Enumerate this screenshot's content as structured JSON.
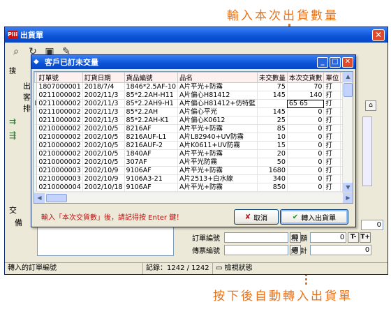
{
  "annotations": {
    "top": "輸入本次出貨數量",
    "bottom": "按下後自動轉入出貨單"
  },
  "outer_window": {
    "title": "出貨單",
    "side_labels": [
      "出",
      "客",
      "排",
      "交",
      "備"
    ],
    "toolbar_label": "搜",
    "fields": {
      "order_no_label": "訂單編號",
      "invoice_no_label": "傳票編號",
      "tax_label": "稅 額",
      "tax_value": "0",
      "total_label": "總 計",
      "total_value": "0",
      "right_value": "0",
      "t_minus": "T-",
      "t_plus": "T+"
    },
    "status_bar": {
      "left": "轉入的訂單編號",
      "records": "記錄：1242 / 1242",
      "mode": "檢視狀態"
    }
  },
  "dialog": {
    "title": "客戶已訂未交量",
    "columns": [
      "訂單號",
      "訂貨日期",
      "貨品編號",
      "品名",
      "未交數量",
      "本次交貨數",
      "單位",
      "單價"
    ],
    "rows": [
      {
        "order": "1807000001",
        "date": "2018/7/4",
        "code": "1846*2.5AF-10",
        "name": "A片平光+防霧",
        "pending": "75",
        "ship": "70",
        "unit": "打",
        "price": ""
      },
      {
        "order": "0211000002",
        "date": "2002/11/3",
        "code": "85*2.2AH-H11",
        "name": "A片偏心H81412",
        "pending": "145",
        "ship": "140",
        "unit": "打",
        "price": ""
      },
      {
        "order": "0211000002",
        "date": "2002/11/3",
        "code": "85*2.2AH9-H1",
        "name": "A片偏心H81412+仿特藍",
        "pending": "",
        "ship": "65 65",
        "unit": "打",
        "price": ""
      },
      {
        "order": "0211000002",
        "date": "2002/11/3",
        "code": "85*2.2AH",
        "name": "A片偏心平光",
        "pending": "145",
        "ship": "0",
        "unit": "打",
        "price": ""
      },
      {
        "order": "0211000002",
        "date": "2002/11/3",
        "code": "85*2.2AH-K1",
        "name": "A片偏心K0612",
        "pending": "25",
        "ship": "0",
        "unit": "打",
        "price": ""
      },
      {
        "order": "0210000002",
        "date": "2002/10/5",
        "code": "8216AF",
        "name": "A片平光+防霧",
        "pending": "85",
        "ship": "0",
        "unit": "打",
        "price": ""
      },
      {
        "order": "0210000002",
        "date": "2002/10/5",
        "code": "8216AUF-L1",
        "name": "A片L82940+UV防霧",
        "pending": "10",
        "ship": "0",
        "unit": "打",
        "price": ""
      },
      {
        "order": "0210000002",
        "date": "2002/10/5",
        "code": "8216AUF-2",
        "name": "A片K0611+UV防霧",
        "pending": "15",
        "ship": "0",
        "unit": "打",
        "price": ""
      },
      {
        "order": "0210000002",
        "date": "2002/10/5",
        "code": "1840AF",
        "name": "A片平光+防霧",
        "pending": "20",
        "ship": "0",
        "unit": "打",
        "price": ""
      },
      {
        "order": "0210000002",
        "date": "2002/10/5",
        "code": "307AF",
        "name": "A片平光防霧",
        "pending": "50",
        "ship": "0",
        "unit": "打",
        "price": ""
      },
      {
        "order": "0210000003",
        "date": "2002/10/9",
        "code": "9106AF",
        "name": "A片平光+防霧",
        "pending": "1680",
        "ship": "0",
        "unit": "打",
        "price": ""
      },
      {
        "order": "0210000003",
        "date": "2002/10/9",
        "code": "9106A3-21",
        "name": "A片2513+白水線",
        "pending": "340",
        "ship": "0",
        "unit": "打",
        "price": ""
      },
      {
        "order": "0210000004",
        "date": "2002/10/18",
        "code": "9106AF",
        "name": "A片平光+防霧",
        "pending": "850",
        "ship": "0",
        "unit": "打",
        "price": ""
      }
    ],
    "hint": "輸入「本次交貨數」後，請記得按 Enter 鍵！",
    "cancel_label": "取消",
    "transfer_label": "轉入出貨單",
    "colors": {
      "title_bar": "#0a53d8",
      "hint": "#c01010",
      "annotation": "#e8721a"
    }
  }
}
